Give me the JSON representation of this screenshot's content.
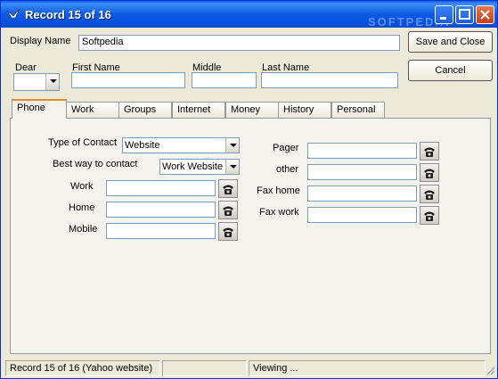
{
  "window": {
    "title": "Record 15 of  16",
    "watermark": "SOFTPEDIA"
  },
  "header": {
    "display_name_label": "Display Name",
    "display_name_value": "Softpedia",
    "save_close_label": "Save and Close",
    "cancel_label": "Cancel",
    "dear_label": "Dear",
    "dear_value": "",
    "first_name_label": "First Name",
    "first_name_value": "",
    "middle_label": "Middle",
    "middle_value": "",
    "last_name_label": "Last Name",
    "last_name_value": ""
  },
  "tabs": [
    {
      "label": "Phone"
    },
    {
      "label": "Work"
    },
    {
      "label": "Groups"
    },
    {
      "label": "Internet"
    },
    {
      "label": "Money"
    },
    {
      "label": "History"
    },
    {
      "label": "Personal"
    }
  ],
  "phone": {
    "type_of_contact_label": "Type of Contact",
    "type_of_contact_value": "Website",
    "best_way_label": "Best way to contact",
    "best_way_value": "Work Website",
    "work_label": "Work",
    "work_value": "",
    "home_label": "Home",
    "home_value": "",
    "mobile_label": "Mobile",
    "mobile_value": "",
    "pager_label": "Pager",
    "pager_value": "",
    "other_label": "other",
    "other_value": "",
    "fax_home_label": "Fax home",
    "fax_home_value": "",
    "fax_work_label": "Fax work",
    "fax_work_value": ""
  },
  "statusbar": {
    "record": "Record 15 of  16 (Yahoo website)",
    "middle": "",
    "mode": "Viewing ..."
  },
  "icons": {
    "title": "bird-app-icon",
    "dial": "telephone-icon"
  },
  "colors": {
    "titlebar": "#0a5fe8",
    "active_tab_accent": "#e68b2c",
    "face": "#ece9d8"
  }
}
